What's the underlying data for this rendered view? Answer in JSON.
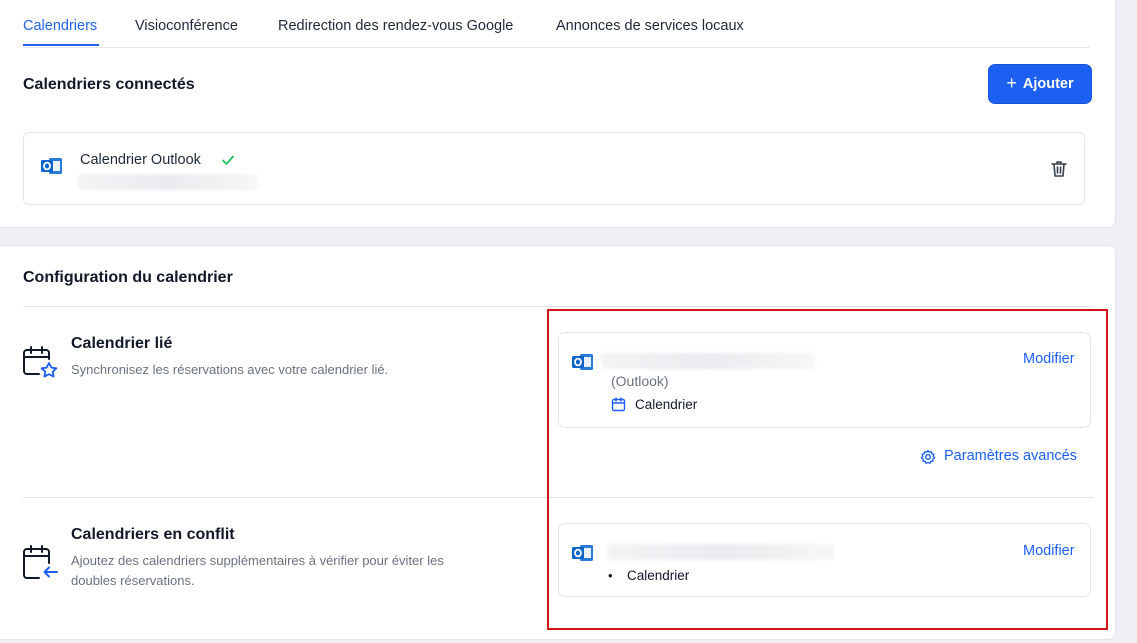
{
  "tabs": [
    {
      "label": "Calendriers"
    },
    {
      "label": "Visioconférence"
    },
    {
      "label": "Redirection des rendez-vous Google"
    },
    {
      "label": "Annonces de services locaux"
    }
  ],
  "connected": {
    "title": "Calendriers connectés",
    "add_label": "Ajouter",
    "account_name": "Calendrier Outlook"
  },
  "config": {
    "title": "Configuration du calendrier",
    "linked": {
      "title": "Calendrier lié",
      "desc": "Synchronisez les réservations avec votre calendrier lié.",
      "provider": "(Outlook)",
      "calendar": "Calendrier",
      "modify": "Modifier",
      "advanced": "Paramètres avancés"
    },
    "conflict": {
      "title": "Calendriers en conflit",
      "desc": "Ajoutez des calendriers supplémentaires à vérifier pour éviter les doubles réservations.",
      "item": "Calendrier",
      "modify": "Modifier"
    }
  },
  "colors": {
    "accent": "#1d5ff0",
    "success": "#22c55e",
    "highlight": "#d0151b"
  }
}
